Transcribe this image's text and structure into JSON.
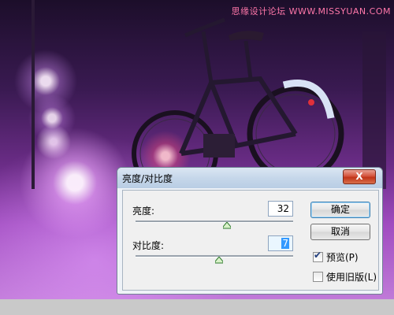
{
  "watermark": "思缘设计论坛 WWW.MISSYUAN.COM",
  "dialog": {
    "title": "亮度/对比度",
    "close_label": "X",
    "brightness": {
      "label": "亮度:",
      "value": "32",
      "slider_fraction": 0.58
    },
    "contrast": {
      "label": "对比度:",
      "value": "7",
      "slider_fraction": 0.53
    },
    "ok_label": "确定",
    "cancel_label": "取消",
    "preview": {
      "label": "预览(P)",
      "checked": true
    },
    "legacy": {
      "label": "使用旧版(L)",
      "checked": false
    }
  },
  "icons": [
    "close-icon",
    "slider-thumb-icon",
    "checkmark-icon"
  ],
  "colors": {
    "accent": "#3399ff",
    "close": "#c03418",
    "photo": "#8a3aaa"
  }
}
